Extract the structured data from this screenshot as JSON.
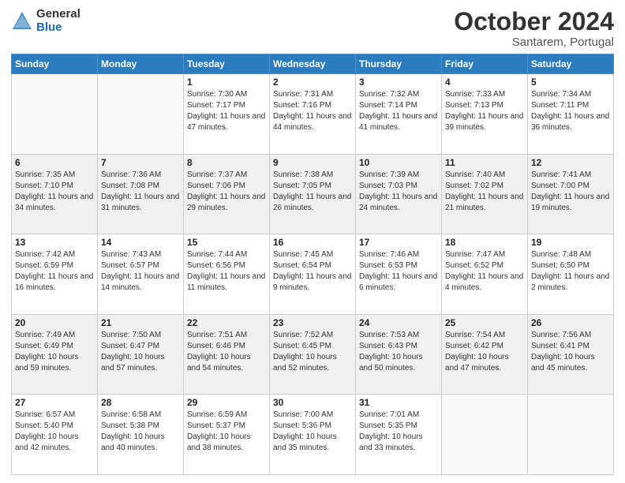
{
  "header": {
    "logo_general": "General",
    "logo_blue": "Blue",
    "title": "October 2024",
    "location": "Santarem, Portugal"
  },
  "days_of_week": [
    "Sunday",
    "Monday",
    "Tuesday",
    "Wednesday",
    "Thursday",
    "Friday",
    "Saturday"
  ],
  "weeks": [
    [
      {
        "day": "",
        "sunrise": "",
        "sunset": "",
        "daylight": ""
      },
      {
        "day": "",
        "sunrise": "",
        "sunset": "",
        "daylight": ""
      },
      {
        "day": "1",
        "sunrise": "Sunrise: 7:30 AM",
        "sunset": "Sunset: 7:17 PM",
        "daylight": "Daylight: 11 hours and 47 minutes."
      },
      {
        "day": "2",
        "sunrise": "Sunrise: 7:31 AM",
        "sunset": "Sunset: 7:16 PM",
        "daylight": "Daylight: 11 hours and 44 minutes."
      },
      {
        "day": "3",
        "sunrise": "Sunrise: 7:32 AM",
        "sunset": "Sunset: 7:14 PM",
        "daylight": "Daylight: 11 hours and 41 minutes."
      },
      {
        "day": "4",
        "sunrise": "Sunrise: 7:33 AM",
        "sunset": "Sunset: 7:13 PM",
        "daylight": "Daylight: 11 hours and 39 minutes."
      },
      {
        "day": "5",
        "sunrise": "Sunrise: 7:34 AM",
        "sunset": "Sunset: 7:11 PM",
        "daylight": "Daylight: 11 hours and 36 minutes."
      }
    ],
    [
      {
        "day": "6",
        "sunrise": "Sunrise: 7:35 AM",
        "sunset": "Sunset: 7:10 PM",
        "daylight": "Daylight: 11 hours and 34 minutes."
      },
      {
        "day": "7",
        "sunrise": "Sunrise: 7:36 AM",
        "sunset": "Sunset: 7:08 PM",
        "daylight": "Daylight: 11 hours and 31 minutes."
      },
      {
        "day": "8",
        "sunrise": "Sunrise: 7:37 AM",
        "sunset": "Sunset: 7:06 PM",
        "daylight": "Daylight: 11 hours and 29 minutes."
      },
      {
        "day": "9",
        "sunrise": "Sunrise: 7:38 AM",
        "sunset": "Sunset: 7:05 PM",
        "daylight": "Daylight: 11 hours and 26 minutes."
      },
      {
        "day": "10",
        "sunrise": "Sunrise: 7:39 AM",
        "sunset": "Sunset: 7:03 PM",
        "daylight": "Daylight: 11 hours and 24 minutes."
      },
      {
        "day": "11",
        "sunrise": "Sunrise: 7:40 AM",
        "sunset": "Sunset: 7:02 PM",
        "daylight": "Daylight: 11 hours and 21 minutes."
      },
      {
        "day": "12",
        "sunrise": "Sunrise: 7:41 AM",
        "sunset": "Sunset: 7:00 PM",
        "daylight": "Daylight: 11 hours and 19 minutes."
      }
    ],
    [
      {
        "day": "13",
        "sunrise": "Sunrise: 7:42 AM",
        "sunset": "Sunset: 6:59 PM",
        "daylight": "Daylight: 11 hours and 16 minutes."
      },
      {
        "day": "14",
        "sunrise": "Sunrise: 7:43 AM",
        "sunset": "Sunset: 6:57 PM",
        "daylight": "Daylight: 11 hours and 14 minutes."
      },
      {
        "day": "15",
        "sunrise": "Sunrise: 7:44 AM",
        "sunset": "Sunset: 6:56 PM",
        "daylight": "Daylight: 11 hours and 11 minutes."
      },
      {
        "day": "16",
        "sunrise": "Sunrise: 7:45 AM",
        "sunset": "Sunset: 6:54 PM",
        "daylight": "Daylight: 11 hours and 9 minutes."
      },
      {
        "day": "17",
        "sunrise": "Sunrise: 7:46 AM",
        "sunset": "Sunset: 6:53 PM",
        "daylight": "Daylight: 11 hours and 6 minutes."
      },
      {
        "day": "18",
        "sunrise": "Sunrise: 7:47 AM",
        "sunset": "Sunset: 6:52 PM",
        "daylight": "Daylight: 11 hours and 4 minutes."
      },
      {
        "day": "19",
        "sunrise": "Sunrise: 7:48 AM",
        "sunset": "Sunset: 6:50 PM",
        "daylight": "Daylight: 11 hours and 2 minutes."
      }
    ],
    [
      {
        "day": "20",
        "sunrise": "Sunrise: 7:49 AM",
        "sunset": "Sunset: 6:49 PM",
        "daylight": "Daylight: 10 hours and 59 minutes."
      },
      {
        "day": "21",
        "sunrise": "Sunrise: 7:50 AM",
        "sunset": "Sunset: 6:47 PM",
        "daylight": "Daylight: 10 hours and 57 minutes."
      },
      {
        "day": "22",
        "sunrise": "Sunrise: 7:51 AM",
        "sunset": "Sunset: 6:46 PM",
        "daylight": "Daylight: 10 hours and 54 minutes."
      },
      {
        "day": "23",
        "sunrise": "Sunrise: 7:52 AM",
        "sunset": "Sunset: 6:45 PM",
        "daylight": "Daylight: 10 hours and 52 minutes."
      },
      {
        "day": "24",
        "sunrise": "Sunrise: 7:53 AM",
        "sunset": "Sunset: 6:43 PM",
        "daylight": "Daylight: 10 hours and 50 minutes."
      },
      {
        "day": "25",
        "sunrise": "Sunrise: 7:54 AM",
        "sunset": "Sunset: 6:42 PM",
        "daylight": "Daylight: 10 hours and 47 minutes."
      },
      {
        "day": "26",
        "sunrise": "Sunrise: 7:56 AM",
        "sunset": "Sunset: 6:41 PM",
        "daylight": "Daylight: 10 hours and 45 minutes."
      }
    ],
    [
      {
        "day": "27",
        "sunrise": "Sunrise: 6:57 AM",
        "sunset": "Sunset: 5:40 PM",
        "daylight": "Daylight: 10 hours and 42 minutes."
      },
      {
        "day": "28",
        "sunrise": "Sunrise: 6:58 AM",
        "sunset": "Sunset: 5:38 PM",
        "daylight": "Daylight: 10 hours and 40 minutes."
      },
      {
        "day": "29",
        "sunrise": "Sunrise: 6:59 AM",
        "sunset": "Sunset: 5:37 PM",
        "daylight": "Daylight: 10 hours and 38 minutes."
      },
      {
        "day": "30",
        "sunrise": "Sunrise: 7:00 AM",
        "sunset": "Sunset: 5:36 PM",
        "daylight": "Daylight: 10 hours and 35 minutes."
      },
      {
        "day": "31",
        "sunrise": "Sunrise: 7:01 AM",
        "sunset": "Sunset: 5:35 PM",
        "daylight": "Daylight: 10 hours and 33 minutes."
      },
      {
        "day": "",
        "sunrise": "",
        "sunset": "",
        "daylight": ""
      },
      {
        "day": "",
        "sunrise": "",
        "sunset": "",
        "daylight": ""
      }
    ]
  ]
}
